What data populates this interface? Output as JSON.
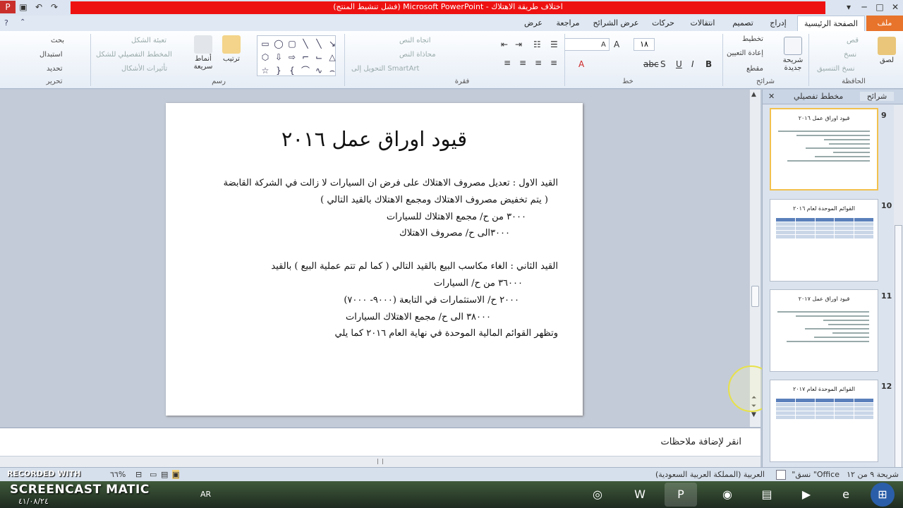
{
  "window": {
    "title": "اختلاف طريقة الاهتلاك - Microsoft PowerPoint (فشل تنشيط المنتج)"
  },
  "tabs": [
    {
      "label": "ملف"
    },
    {
      "label": "الصفحة الرئيسية"
    },
    {
      "label": "إدراج"
    },
    {
      "label": "تصميم"
    },
    {
      "label": "انتقالات"
    },
    {
      "label": "حركات"
    },
    {
      "label": "عرض الشرائح"
    },
    {
      "label": "مراجعة"
    },
    {
      "label": "عرض"
    }
  ],
  "ribbon": {
    "clipboard": {
      "paste": "لصق",
      "cut": "قص",
      "copy": "نسخ",
      "format_painter": "نسخ التنسيق",
      "group": "الحافظة"
    },
    "slides": {
      "new_slide": "شريحة جديدة",
      "layout": "تخطيط",
      "reset": "إعادة التعيين",
      "section": "مقطع",
      "group": "شرائح"
    },
    "font": {
      "size": "١٨",
      "group": "خط"
    },
    "paragraph": {
      "text_direction": "اتجاه النص",
      "align_text": "محاذاة النص",
      "smartart": "التحويل إلى SmartArt",
      "group": "فقرة"
    },
    "drawing": {
      "arrange": "ترتيب",
      "quick_styles": "أنماط سريعة",
      "shape_fill": "تعبئة الشكل",
      "shape_outline": "المخطط التفصيلي للشكل",
      "shape_effects": "تأثيرات الأشكال",
      "group": "رسم"
    },
    "editing": {
      "find": "بحث",
      "replace": "استبدال",
      "select": "تحديد",
      "group": "تحرير"
    }
  },
  "slide": {
    "title": "قيود اوراق عمل ٢٠١٦",
    "lines": [
      "القيد الاول : تعديل مصروف الاهتلاك على فرض ان السيارات لا زالت في الشركة القابضة",
      "( يتم تخفيض مصروف الاهتلاك ومجمع الاهتلاك بالقيد التالي )",
      "٣٠٠٠ من ح/ مجمع الاهتلاك للسيارات",
      "٣٠٠٠الى ح/ مصروف الاهتلاك",
      "القيد الثاني : الغاء مكاسب البيع بالقيد التالي ( كما لم تتم عملية البيع ) بالقيد",
      "٣٦٠٠٠ من ح/ السيارات",
      "٢٠٠٠ ح/ الاستثمارات في التابعة (٩٠٠٠- ٧٠٠٠)",
      "٣٨٠٠٠ الى ح/ مجمع الاهتلاك السيارات",
      "وتظهر القوائم المالية الموحدة في نهاية العام ٢٠١٦ كما يلي"
    ]
  },
  "notes": {
    "placeholder": "انقر لإضافة ملاحظات"
  },
  "panel": {
    "tab_slides": "شرائح",
    "tab_outline": "مخطط تفصيلي",
    "thumbnails": [
      {
        "number": "9",
        "title": "قيود اوراق عمل ٢٠١٦",
        "kind": "text",
        "selected": true
      },
      {
        "number": "10",
        "title": "القوائم الموحدة لعام ٢٠١٦",
        "kind": "table",
        "selected": false
      },
      {
        "number": "11",
        "title": "قيود اوراق عمل ٢٠١٧",
        "kind": "text",
        "selected": false
      },
      {
        "number": "12",
        "title": "القوائم الموحدة لعام ٢٠١٧",
        "kind": "table",
        "selected": false
      }
    ]
  },
  "status": {
    "slide_of": "شريحة ٩ من ١٢",
    "theme": "\"نسق \"Office",
    "language": "العربية (المملكة العربية السعودية)",
    "zoom": "٦٦%"
  },
  "taskbar": {
    "lang": "AR"
  },
  "watermark": {
    "recorded": "RECORDED WITH",
    "brand": "SCREENCAST MATIC",
    "date": "٤١/٠٨/٢٤"
  }
}
